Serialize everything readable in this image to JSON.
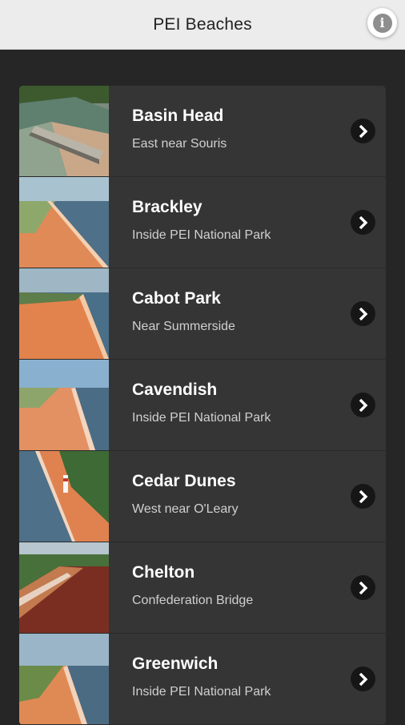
{
  "header": {
    "title": "PEI Beaches",
    "info_icon": "info-icon"
  },
  "beaches": [
    {
      "name": "Basin Head",
      "location": "East near Souris"
    },
    {
      "name": "Brackley",
      "location": "Inside PEI National Park"
    },
    {
      "name": "Cabot Park",
      "location": "Near Summerside"
    },
    {
      "name": "Cavendish",
      "location": "Inside PEI National Park"
    },
    {
      "name": "Cedar Dunes",
      "location": "West near O'Leary"
    },
    {
      "name": "Chelton",
      "location": "Confederation Bridge"
    },
    {
      "name": "Greenwich",
      "location": "Inside PEI National Park"
    }
  ],
  "colors": {
    "header_bg": "#ececec",
    "page_bg": "#262626",
    "row_bg": "#353535",
    "sand": "#d9774a",
    "sea": "#4a6f88"
  }
}
